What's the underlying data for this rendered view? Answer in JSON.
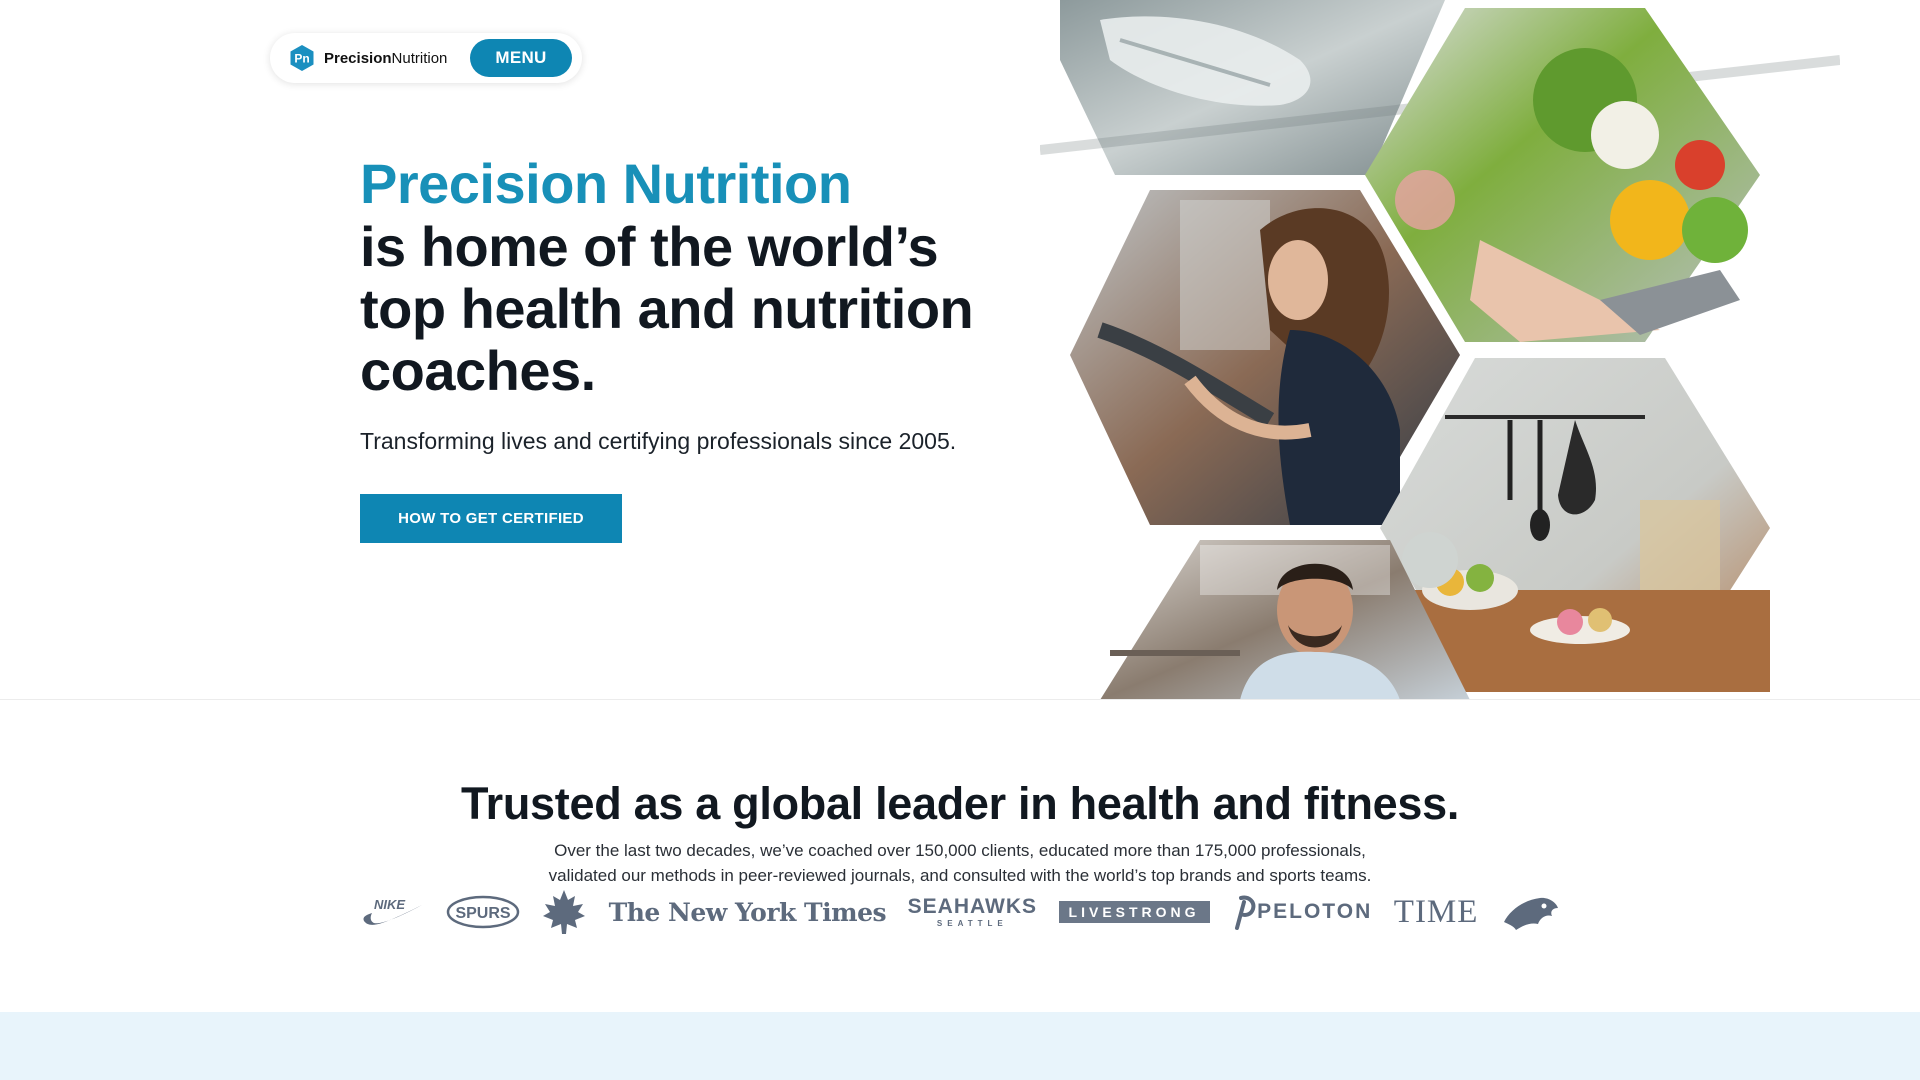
{
  "header": {
    "logo_icon": "pn-hexagon-logo-icon",
    "logo_bold": "Precision",
    "logo_light": "Nutrition",
    "logo_mark_text": "Pn",
    "menu_label": "MENU"
  },
  "hero": {
    "brand": "Precision Nutrition",
    "headline": "is home of the world’s top health and nutrition coaches.",
    "subtitle": "Transforming lives and certifying professionals since 2005.",
    "cta_label": "HOW TO GET CERTIFIED"
  },
  "collage": {
    "tiles": [
      "running-shoe-treadmill-photo",
      "vegetables-laptop-photo",
      "woman-gym-bike-photo",
      "kitchen-utensils-fruit-photo",
      "man-smiling-kitchen-photo"
    ]
  },
  "trusted": {
    "heading": "Trusted as a global leader in health and fitness.",
    "copy_line1": "Over the last two decades, we’ve coached over 150,000 clients, educated more than 175,000 professionals,",
    "copy_line2": "validated our methods in peer-reviewed journals, and consulted with the world’s top brands and sports teams.",
    "logos": {
      "nike": "NIKE",
      "spurs": "SPURS",
      "maple_leafs": "maple-leafs-icon",
      "nyt": "The New York Times",
      "seahawks_top": "SEAHAWKS",
      "seahawks_bottom": "SEATTLE",
      "livestrong": "LIVESTRONG",
      "peloton": "PELOTON",
      "time": "TIME",
      "panthers": "panther-head-icon"
    }
  },
  "colors": {
    "accent": "#0e86b3",
    "brand_blue": "#1890b8",
    "logo_gray": "#5d6a7d",
    "band": "#e8f4fb"
  }
}
